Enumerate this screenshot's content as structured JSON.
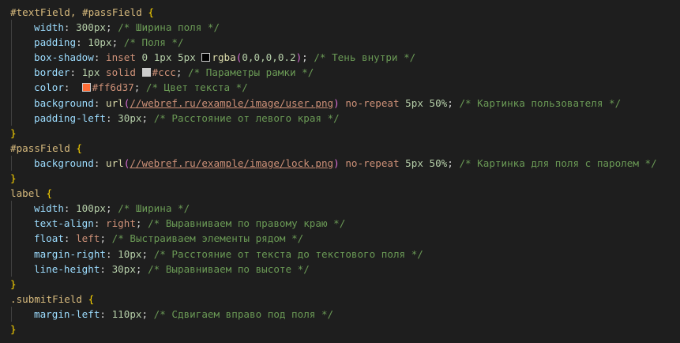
{
  "colors": {
    "background": "#1e1e1e",
    "selector": "#d7ba7d",
    "property": "#9cdcfe",
    "number": "#b5cea8",
    "value": "#ce9178",
    "function": "#dcdcaa",
    "comment": "#6a9955",
    "bracket": "#ffd700"
  },
  "swatches": {
    "rgba_black": "#000000",
    "ccc": "#cccccc",
    "ff6d37": "#ff6d37"
  },
  "code": {
    "rule1": {
      "selector": "#textField, #passField",
      "open": " {",
      "l1": {
        "prop": "width",
        "val": "300px",
        "comment": "/* Ширина поля */"
      },
      "l2": {
        "prop": "padding",
        "val": "10px",
        "comment": "/* Поля */"
      },
      "l3": {
        "prop": "box-shadow",
        "v1": "inset",
        "v2": "0",
        "v3": "1px",
        "v4": "5px",
        "fn": "rgba",
        "args": "0,0,0,0.2",
        "comment": "/* Тень внутри */"
      },
      "l4": {
        "prop": "border",
        "v1": "1px",
        "v2": "solid",
        "color": "#ccc",
        "comment": "/* Параметры рамки */"
      },
      "l5": {
        "prop": "color",
        "color": "#ff6d37",
        "comment": "/* Цвет текста */"
      },
      "l6": {
        "prop": "background",
        "fn": "url",
        "url": "//webref.ru/example/image/user.png",
        "v1": "no-repeat",
        "v2": "5px",
        "v3": "50%",
        "comment": "/* Картинка пользователя */"
      },
      "l7": {
        "prop": "padding-left",
        "val": "30px",
        "comment": "/* Расстояние от левого края */"
      },
      "close": "}"
    },
    "rule2": {
      "selector": "#passField",
      "open": " {",
      "l1": {
        "prop": "background",
        "fn": "url",
        "url": "//webref.ru/example/image/lock.png",
        "v1": "no-repeat",
        "v2": "5px",
        "v3": "50%",
        "comment": "/* Картинка для поля с паролем */"
      },
      "close": "}"
    },
    "rule3": {
      "selector": "label",
      "open": " {",
      "l1": {
        "prop": "width",
        "val": "100px",
        "comment": "/* Ширина */"
      },
      "l2": {
        "prop": "text-align",
        "val": "right",
        "comment": "/* Выравниваем по правому краю */"
      },
      "l3": {
        "prop": "float",
        "val": "left",
        "comment": "/* Выстраиваем элементы рядом */"
      },
      "l4": {
        "prop": "margin-right",
        "val": "10px",
        "comment": "/* Расстояние от текста до текстового поля */"
      },
      "l5": {
        "prop": "line-height",
        "val": "30px",
        "comment": "/* Выравниваем по высоте */"
      },
      "close": "}"
    },
    "rule4": {
      "selector": ".submitField",
      "open": " {",
      "l1": {
        "prop": "margin-left",
        "val": "110px",
        "comment": "/* Сдвигаем вправо под поля */"
      },
      "close": "}"
    }
  }
}
